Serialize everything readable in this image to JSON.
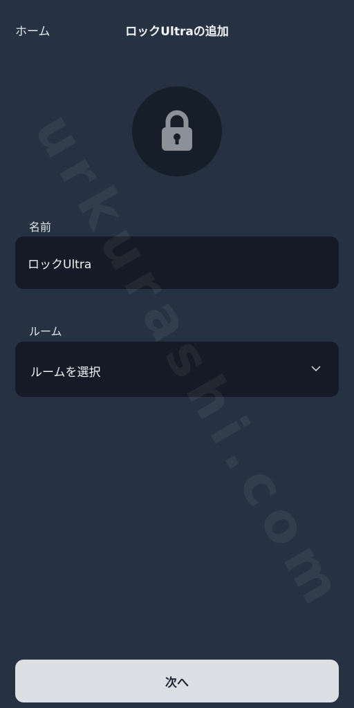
{
  "header": {
    "back_label": "ホーム",
    "title": "ロックUltraの追加"
  },
  "device_icon": "lock-icon",
  "form": {
    "name_label": "名前",
    "name_value": "ロックUltra",
    "room_label": "ルーム",
    "room_placeholder": "ルームを選択"
  },
  "next_button_label": "次へ",
  "watermark": "urkurashi.com",
  "colors": {
    "background": "#263241",
    "field_background": "#151b26",
    "icon_circle": "#161e29",
    "lock_icon": "#8b9099",
    "button_background": "#dcdfe3"
  }
}
